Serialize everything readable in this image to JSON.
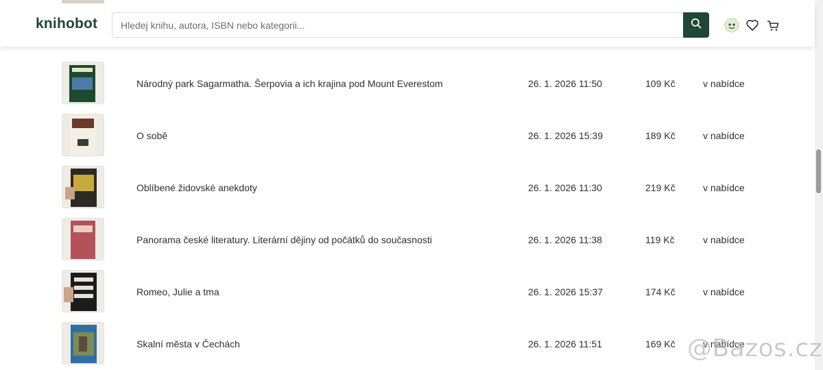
{
  "header": {
    "logo": "knihobot",
    "search_placeholder": "Hledej knihu, autora, ISBN nebo kategorii...",
    "icons": [
      "search-icon",
      "avatar-icon",
      "heart-icon",
      "cart-icon"
    ]
  },
  "rows": [
    {
      "title": "Národný park Sagarmatha. Šerpovia a ich krajina pod Mount Everestom",
      "date": "26. 1. 2026 11:50",
      "price": "109 Kč",
      "status": "v nabídce"
    },
    {
      "title": "O sobě",
      "date": "26. 1. 2026 15:39",
      "price": "189 Kč",
      "status": "v nabídce"
    },
    {
      "title": "Oblíbené židovské anekdoty",
      "date": "26. 1. 2026 11:30",
      "price": "219 Kč",
      "status": "v nabídce"
    },
    {
      "title": "Panorama české literatury. Literární dějiny od počátků do současnosti",
      "date": "26. 1. 2026 11:38",
      "price": "119 Kč",
      "status": "v nabídce"
    },
    {
      "title": "Romeo, Julie a tma",
      "date": "26. 1. 2026 15:37",
      "price": "174 Kč",
      "status": "v nabídce"
    },
    {
      "title": "Skalní města v Čechách",
      "date": "26. 1. 2026 11:51",
      "price": "169 Kč",
      "status": "v nabídce"
    }
  ],
  "watermark": "@Bazos.cz",
  "colors": {
    "brand": "#1f4732",
    "text": "#2f2f2f"
  }
}
